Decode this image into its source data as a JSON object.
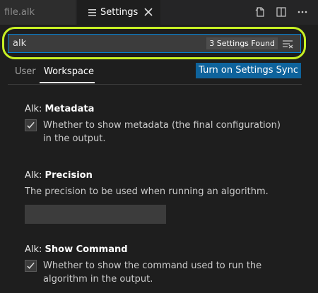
{
  "tabs": {
    "file_label": "file.alk",
    "settings_label": "Settings"
  },
  "search": {
    "value": "alk",
    "placeholder": "",
    "results_count": "3 Settings Found"
  },
  "scopes": {
    "user": "User",
    "workspace": "Workspace"
  },
  "sync_button_label": "Turn on Settings Sync",
  "settings": [
    {
      "category": "Alk: ",
      "key": "Metadata",
      "description": "Whether to show metadata (the final configuration) in the output.",
      "checked": true
    },
    {
      "category": "Alk: ",
      "key": "Precision",
      "description": "The precision to be used when running an algorithm.",
      "value": ""
    },
    {
      "category": "Alk: ",
      "key": "Show Command",
      "description": "Whether to show the command used to run the algorithm in the output.",
      "checked": true
    }
  ],
  "colors": {
    "accent": "#0e639c",
    "focus_border": "#007fd4",
    "highlight_ring": "#c7f024",
    "background": "#1e1e1e"
  },
  "icons": {
    "settings_tab": "settings-list-icon",
    "close_tab": "close-icon",
    "open_json": "open-settings-json-icon",
    "split_editor": "split-editor-icon",
    "more_actions": "more-actions-icon",
    "clear_filter": "clear-filter-icon",
    "checkbox": "checkmark-icon"
  }
}
